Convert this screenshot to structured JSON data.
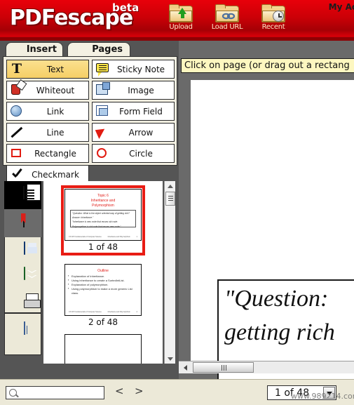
{
  "header": {
    "logo_pdf": "PDF",
    "logo_escape": "escape",
    "beta": "beta",
    "tools": [
      {
        "label": "Upload",
        "icon": "folder-upload-icon"
      },
      {
        "label": "Load URL",
        "icon": "folder-link-icon"
      },
      {
        "label": "Recent",
        "icon": "folder-clock-icon"
      }
    ],
    "account_label": "My Ac"
  },
  "tabs": [
    {
      "label": "Insert",
      "active": true
    },
    {
      "label": "Pages",
      "active": false
    }
  ],
  "tools": [
    {
      "label": "Text",
      "icon": "text-icon",
      "active": true
    },
    {
      "label": "Sticky Note",
      "icon": "sticky-note-icon",
      "active": false
    },
    {
      "label": "Whiteout",
      "icon": "whiteout-icon",
      "active": false
    },
    {
      "label": "Image",
      "icon": "image-icon",
      "active": false
    },
    {
      "label": "Link",
      "icon": "link-icon",
      "active": false
    },
    {
      "label": "Form Field",
      "icon": "form-field-icon",
      "active": false
    },
    {
      "label": "Line",
      "icon": "line-icon",
      "active": false
    },
    {
      "label": "Arrow",
      "icon": "arrow-icon",
      "active": false
    },
    {
      "label": "Rectangle",
      "icon": "rectangle-icon",
      "active": false
    },
    {
      "label": "Circle",
      "icon": "circle-icon",
      "active": false
    },
    {
      "label": "Checkmark",
      "icon": "checkmark-icon",
      "active": false
    }
  ],
  "rail": [
    {
      "name": "pages-panel",
      "icon": "pages-icon",
      "state": "selected-black"
    },
    {
      "name": "bookmarks-panel",
      "icon": "bookmark-document-icon",
      "state": "selected-gray"
    },
    {
      "name": "save-document",
      "icon": "floppy-save-icon",
      "state": "normal"
    },
    {
      "name": "download-document",
      "icon": "green-download-icon",
      "state": "normal"
    },
    {
      "name": "print-document",
      "icon": "printer-icon",
      "state": "normal"
    },
    {
      "name": "form-fields-panel",
      "icon": "form-field-icon",
      "state": "normal"
    }
  ],
  "thumbnails": [
    {
      "label": "1 of 48",
      "selected": true,
      "title": "Topic 6\nInheritance and\nPolymorphism",
      "quote_line1": "\"Question: What is the object oriented way of getting rich?",
      "quote_line2": "Answer: Inheritance.\"",
      "quote_line3": "\"Inheritance is new code that reuses old code.",
      "quote_line4": "Polymorphism is old code that reuses new code.\"",
      "footer_left": "CS 307 Fundamentals of Computer Science",
      "footer_right": "Inheritance and Polymorphism",
      "footer_page": "1"
    },
    {
      "label": "2 of 48",
      "selected": false,
      "title": "Outline",
      "bullets": [
        "Explanation of inheritance.",
        "Using inheritance to create a SortedIntList.",
        "Explanation of polymorphism.",
        "Using polymorphism to make a more generic List class."
      ],
      "footer_left": "CS 307 Fundamentals of Computer Science",
      "footer_right": "Inheritance and Polymorphism",
      "footer_page": "2"
    },
    {
      "label": "",
      "selected": false,
      "title": "",
      "blank": true
    }
  ],
  "main": {
    "hint": "Click on page (or drag out a rectang",
    "page_text_line1": "\"Question:",
    "page_text_line2": "getting rich"
  },
  "bottom": {
    "search_value": "",
    "search_placeholder": "",
    "search_icon": "search-icon",
    "prev_label": "<",
    "next_label": ">",
    "page_indicator": "1 of 48"
  },
  "watermark": "www.989214.com",
  "colors": {
    "brand_red": "#cc0007",
    "accent_gold": "#f5cf66",
    "selection_red": "#e81c14",
    "panel_beige": "#ece9d8"
  }
}
